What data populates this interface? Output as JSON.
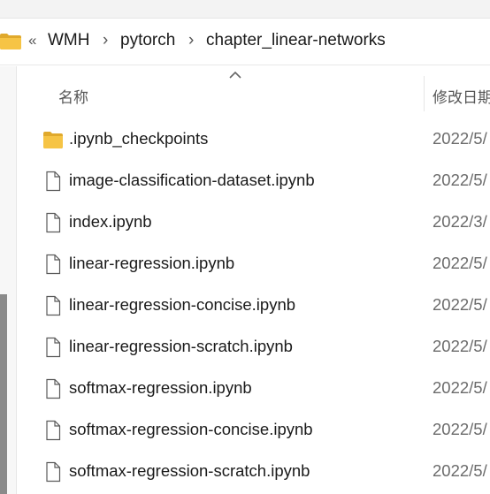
{
  "breadcrumb": {
    "overflow": "«",
    "separator": "›",
    "items": [
      "WMH",
      "pytorch",
      "chapter_linear-networks"
    ]
  },
  "columns": {
    "name": "名称",
    "modified": "修改日期"
  },
  "files": [
    {
      "name": ".ipynb_checkpoints",
      "date": "2022/5/",
      "icon": "folder-icon"
    },
    {
      "name": "image-classification-dataset.ipynb",
      "date": "2022/5/",
      "icon": "file-icon"
    },
    {
      "name": "index.ipynb",
      "date": "2022/3/",
      "icon": "file-icon"
    },
    {
      "name": "linear-regression.ipynb",
      "date": "2022/5/",
      "icon": "file-icon"
    },
    {
      "name": "linear-regression-concise.ipynb",
      "date": "2022/5/",
      "icon": "file-icon"
    },
    {
      "name": "linear-regression-scratch.ipynb",
      "date": "2022/5/",
      "icon": "file-icon"
    },
    {
      "name": "softmax-regression.ipynb",
      "date": "2022/5/",
      "icon": "file-icon"
    },
    {
      "name": "softmax-regression-concise.ipynb",
      "date": "2022/5/",
      "icon": "file-icon"
    },
    {
      "name": "softmax-regression-scratch.ipynb",
      "date": "2022/5/",
      "icon": "file-icon"
    }
  ],
  "colors": {
    "folder": "#f6c445",
    "folder_dark": "#e0a92c",
    "file_outline": "#5a5a5a"
  }
}
